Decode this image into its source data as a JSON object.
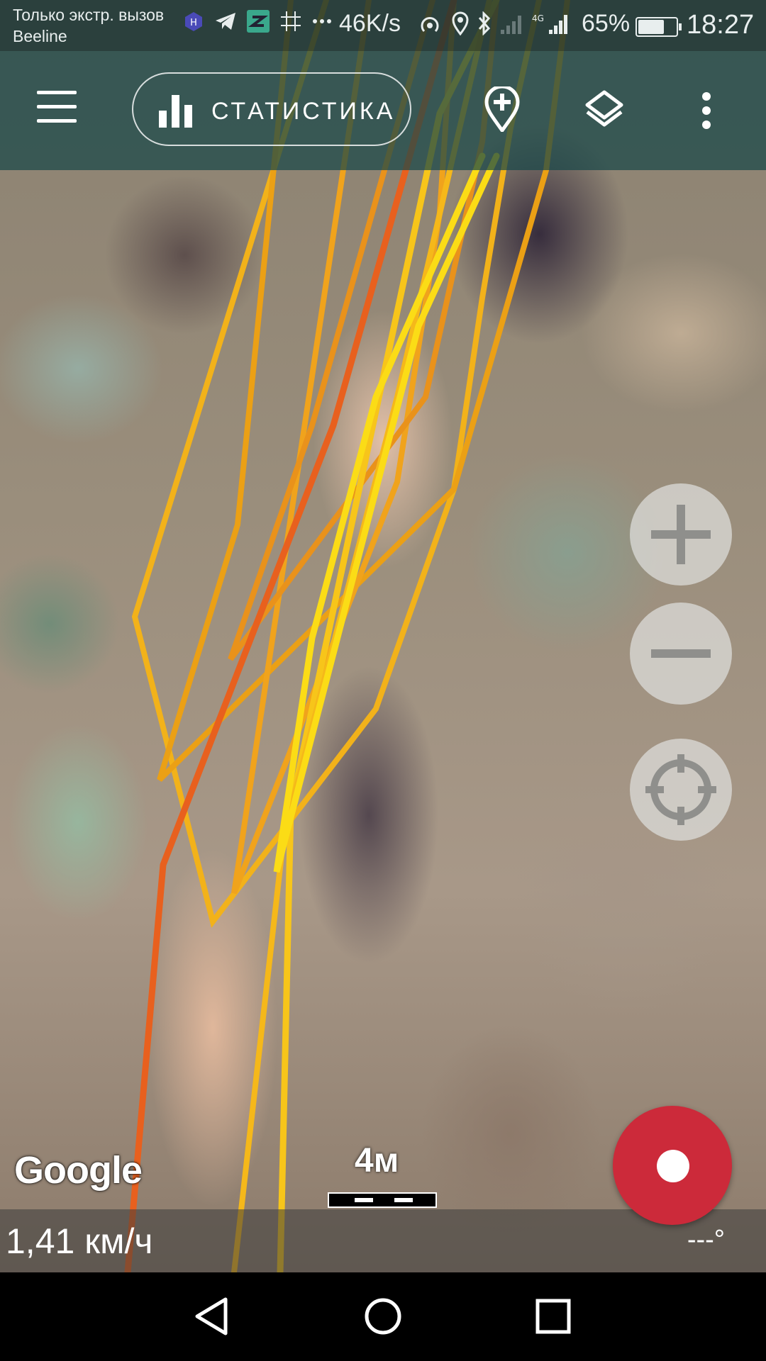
{
  "status_bar": {
    "carrier_line1": "Только экстр. вызов",
    "carrier_line2": "Beeline",
    "net_speed": "46K/s",
    "battery_percent": "65%",
    "battery_level": 0.65,
    "time": "18:27",
    "icons": [
      "app-icon",
      "telegram-icon",
      "app-icon",
      "grid-icon",
      "more-icon",
      "hotspot-icon",
      "location-icon",
      "bluetooth-icon",
      "signal-off-icon",
      "4g-icon",
      "signal-icon",
      "battery-icon"
    ]
  },
  "toolbar": {
    "menu_icon": "hamburger-icon",
    "stats_label": "СТАТИСТИКА",
    "stats_icon": "bar-chart-icon",
    "add_marker_icon": "add-location-icon",
    "layers_icon": "layers-icon",
    "overflow_icon": "more-vert-icon"
  },
  "map": {
    "attribution": "Google",
    "scale_label": "4м",
    "track_colors": [
      "#f2b21a",
      "#ee9a1c",
      "#e8601e",
      "#fbdc16"
    ]
  },
  "controls": {
    "zoom_in_icon": "plus-icon",
    "zoom_out_icon": "minus-icon",
    "locate_icon": "my-location-icon",
    "record_icon": "record-icon",
    "record_color": "#cc2a3a"
  },
  "info_bar": {
    "speed": "1,41 км/ч",
    "heading": "---°"
  },
  "nav_bar": {
    "back_icon": "back-icon",
    "home_icon": "home-icon",
    "recents_icon": "recents-icon"
  }
}
